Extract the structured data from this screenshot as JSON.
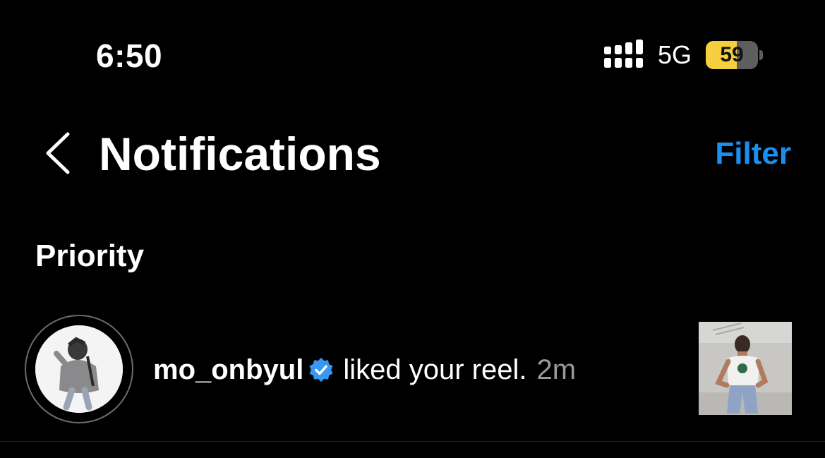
{
  "status_bar": {
    "time": "6:50",
    "network": "5G",
    "battery_level": "59",
    "battery_fraction": 0.59,
    "battery_color": "#f5cf3d",
    "signal_icon": "signal-strength-icon"
  },
  "header": {
    "title": "Notifications",
    "filter_label": "Filter",
    "back_icon": "chevron-left-icon",
    "accent_color": "#1b8ff0"
  },
  "section": {
    "title": "Priority"
  },
  "notifications": [
    {
      "username": "mo_onbyul",
      "verified": true,
      "action": "liked your reel.",
      "time": "2m"
    }
  ]
}
